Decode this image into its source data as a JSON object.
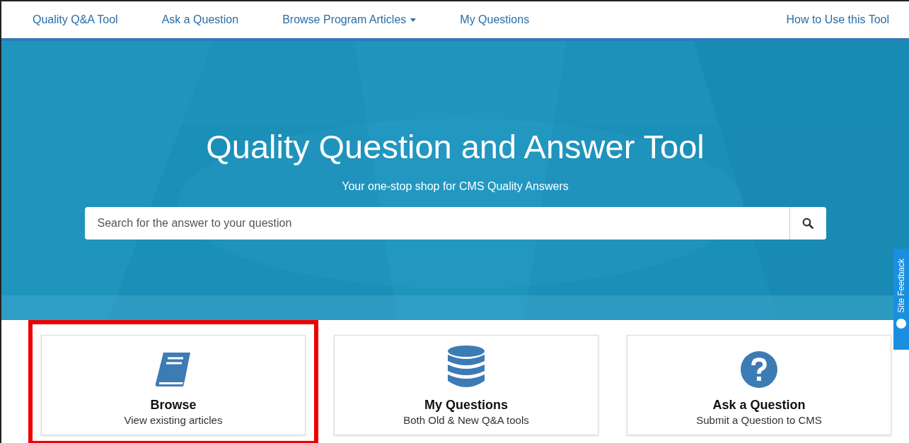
{
  "nav": {
    "items": [
      {
        "label": "Quality Q&A Tool",
        "kind": "brand"
      },
      {
        "label": "Ask a Question",
        "kind": "link"
      },
      {
        "label": "Browse Program Articles",
        "kind": "dropdown"
      },
      {
        "label": "My Questions",
        "kind": "link"
      }
    ],
    "right": {
      "label": "How to Use this Tool"
    }
  },
  "hero": {
    "title": "Quality Question and Answer Tool",
    "subtitle": "Your one-stop shop for CMS Quality Answers",
    "search": {
      "placeholder": "Search for the answer to your question"
    }
  },
  "feedback_tab": {
    "label": "Site Feedback"
  },
  "cards": [
    {
      "kind": "book",
      "title": "Browse",
      "subtitle": "View existing articles",
      "highlighted": true
    },
    {
      "kind": "database",
      "title": "My Questions",
      "subtitle": "Both Old & New Q&A tools",
      "highlighted": false
    },
    {
      "kind": "question",
      "title": "Ask a Question",
      "subtitle": "Submit a Question to CMS",
      "highlighted": false
    }
  ]
}
